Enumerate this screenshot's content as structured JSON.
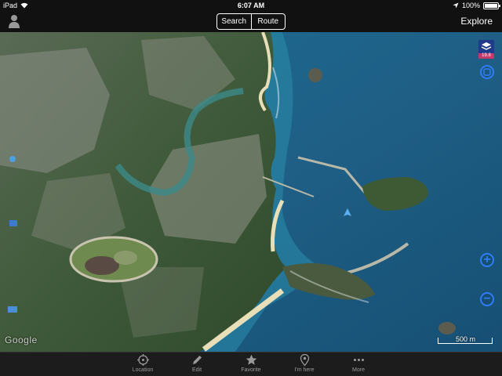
{
  "status": {
    "device": "iPad",
    "time": "6:07 AM",
    "battery": "100%",
    "battery_level": 1.0
  },
  "nav": {
    "search_label": "Search",
    "route_label": "Route",
    "explore_label": "Explore"
  },
  "map": {
    "layer_badge": "19.8",
    "scale_label": "500 m",
    "attribution": "Google"
  },
  "tabs": [
    {
      "label": "Location",
      "icon": "location-target-icon"
    },
    {
      "label": "Edit",
      "icon": "pencil-icon"
    },
    {
      "label": "Favorite",
      "icon": "star-icon"
    },
    {
      "label": "I'm here",
      "icon": "map-pin-icon"
    },
    {
      "label": "More",
      "icon": "more-dots-icon"
    }
  ],
  "colors": {
    "accent": "#2f7df6",
    "badge": "#c23a6a",
    "bar_bg": "#111111",
    "tab_bg": "#1c1c1c",
    "tab_text": "#9a9a9a"
  }
}
